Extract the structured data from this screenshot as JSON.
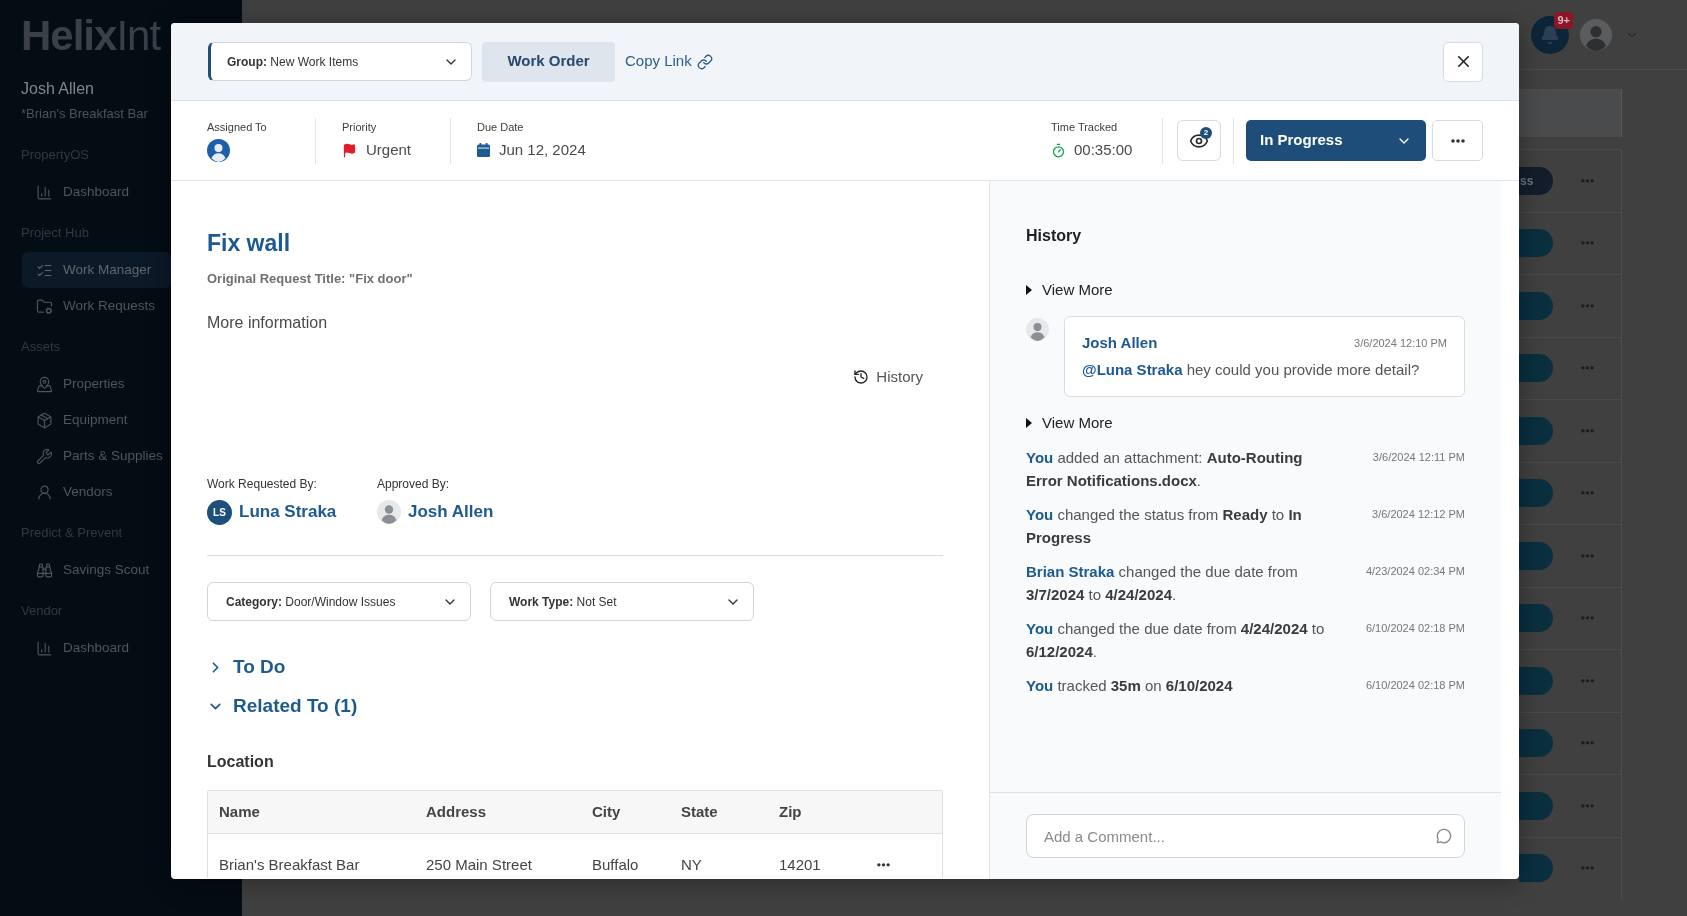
{
  "app_sidebar": {
    "logo": "**Helix**Int",
    "user": "Josh Allen",
    "organization": "*Brian's Breakfast Bar",
    "sections": [
      {
        "title": "PropertyOS",
        "items": [
          {
            "label": "Dashboard",
            "selected": false
          }
        ]
      },
      {
        "title": "Project Hub",
        "items": [
          {
            "label": "Work Manager",
            "selected": true
          },
          {
            "label": "Work Requests",
            "selected": false
          }
        ]
      },
      {
        "title": "Assets",
        "items": [
          {
            "label": "Properties",
            "selected": false
          },
          {
            "label": "Equipment",
            "selected": false
          },
          {
            "label": "Parts & Supplies",
            "selected": false
          },
          {
            "label": "Vendors",
            "selected": false
          }
        ]
      },
      {
        "title": "Predict & Prevent",
        "items": [
          {
            "label": "Savings Scout",
            "selected": false
          }
        ]
      },
      {
        "title": "Vendor",
        "items": [
          {
            "label": "Dashboard",
            "selected": false
          }
        ]
      }
    ]
  },
  "top_bar": {
    "notification_count": "9+"
  },
  "background_rows": [
    {
      "status": "ss",
      "color": "#121e2b"
    },
    {
      "color": "#0a2f3f"
    },
    {
      "color": "#0a2f3f"
    },
    {
      "color": "#0a2f3f"
    },
    {
      "color": "#0a2f3f"
    },
    {
      "color": "#0a2f3f"
    },
    {
      "color": "#0a2f3f"
    },
    {
      "color": "#0a2f3f"
    },
    {
      "color": "#0a2f3f"
    },
    {
      "color": "#0a2f3f"
    },
    {
      "color": "#0a2f3f"
    },
    {
      "color": "#0a2f3f"
    }
  ],
  "work_order": {
    "header": {
      "group_select": {
        "label": "Group:",
        "value": "New Work Items"
      },
      "view_button": "Work Order",
      "copy_link": "Copy Link"
    },
    "info_bar": {
      "fields": [
        {
          "kind": "assignee",
          "label": "Assigned To"
        },
        {
          "kind": "priority",
          "label": "Priority",
          "value": "Urgent"
        },
        {
          "kind": "date",
          "label": "Due Date",
          "value": "Jun 12, 2024"
        }
      ],
      "time_tracked": {
        "label": "Time Tracked",
        "value": "00:35:00"
      },
      "watchers_count": "2",
      "status": "In Progress"
    },
    "details": {
      "title": "Fix wall",
      "original_request": "Original Request Title: \"Fix door\"",
      "description": "More information",
      "history_link": "History",
      "people": [
        {
          "kind": "initials",
          "label": "Work Requested By:",
          "initials": "LS",
          "name": "Luna Straka"
        },
        {
          "kind": "photo",
          "label": "Approved By:",
          "name": "Josh Allen"
        }
      ],
      "selects": [
        {
          "label": "Category:",
          "value": "Door/Window Issues"
        },
        {
          "label": "Work Type:",
          "value": "Not Set"
        }
      ],
      "sections": [
        {
          "title": "To Do",
          "expanded": false
        },
        {
          "title": "Related To (1)",
          "expanded": true
        }
      ],
      "location": {
        "title": "Location",
        "columns": [
          "Name",
          "Address",
          "City",
          "State",
          "Zip"
        ],
        "rows": [
          [
            "Brian's Breakfast Bar",
            "250 Main Street",
            "Buffalo",
            "NY",
            "14201"
          ]
        ]
      }
    },
    "history": {
      "title": "History",
      "items": [
        {
          "kind": "view_more",
          "label": "View More"
        },
        {
          "kind": "comment",
          "author": "Josh Allen",
          "time": "3/6/2024 12:10 PM",
          "mention": "@Luna Straka",
          "text": "hey could you provide more detail?"
        },
        {
          "kind": "view_more",
          "label": "View More"
        },
        {
          "kind": "event",
          "actor": "You",
          "text": "added an attachment: **Auto-Routing Error Notifications.docx**.",
          "time": "3/6/2024 12:11 PM"
        },
        {
          "kind": "event",
          "actor": "You",
          "text": "changed the status from **Ready** to **In Progress**",
          "time": "3/6/2024 12:12 PM"
        },
        {
          "kind": "event",
          "actor": "Brian Straka",
          "text": "changed the due date from **3/7/2024** to **4/24/2024**.",
          "time": "4/23/2024 02:34 PM"
        },
        {
          "kind": "event",
          "actor": "You",
          "text": "changed the due date from **4/24/2024** to **6/12/2024**.",
          "time": "6/10/2024 02:18 PM"
        },
        {
          "kind": "event",
          "actor": "You",
          "text": "tracked **35m** on **6/10/2024**",
          "time": "6/10/2024 02:18 PM"
        }
      ],
      "comment_box": {
        "placeholder": "Add a Comment..."
      }
    }
  }
}
